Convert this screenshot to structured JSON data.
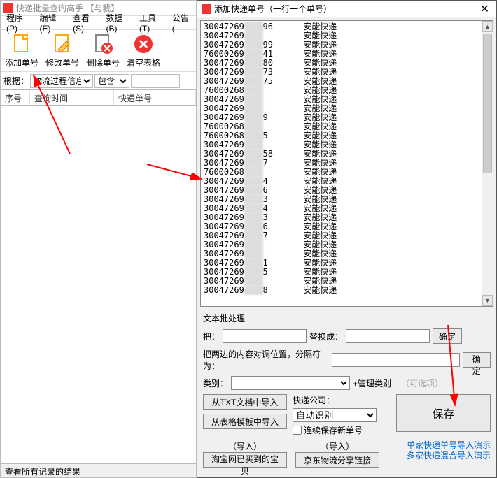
{
  "main": {
    "title": "快递批量查询高手 【与我】",
    "menu": [
      "程序(P)",
      "编辑(E)",
      "查看(S)",
      "数据(B)",
      "工具(T)",
      "公告("
    ],
    "toolbar": [
      {
        "name": "add",
        "label": "添加单号"
      },
      {
        "name": "edit",
        "label": "修改单号"
      },
      {
        "name": "del",
        "label": "删除单号"
      },
      {
        "name": "clear",
        "label": "清空表格"
      }
    ],
    "filter": {
      "root": "根据：",
      "sel1": "物流过程信息",
      "sel2": "包含",
      "q": ""
    },
    "cols": [
      "序号",
      "查询时间",
      "快递单号"
    ],
    "status": "查看所有记录的结果"
  },
  "dialog": {
    "title": "添加快递单号（一行一个单号）",
    "lines": [
      "30047269▮▮96      安能快递",
      "30047269▮▮        安能快递",
      "30047269▮▮99      安能快递",
      "76000269▮▮41      安能快递",
      "30047269▮▮80      安能快递",
      "30047269▮▮73      安能快递",
      "30047269▮▮75      安能快递",
      "76000268▮▮        安能快递",
      "30047269▮▮        安能快递",
      "30047269▮▮        安能快递",
      "30047269▮▮9       安能快递",
      "76000268▮▮        安能快递",
      "76000268▮▮5       安能快递",
      "30047269▮▮        安能快递",
      "30047269▮▮58      安能快递",
      "30047269▮▮7       安能快递",
      "76000268▮▮        安能快递",
      "30047269▮▮4       安能快递",
      "30047269▮▮6       安能快递",
      "30047269▮▮3       安能快递",
      "30047269▮▮4       安能快递",
      "30047269▮▮3       安能快递",
      "30047269▮▮6       安能快递",
      "30047269▮▮7       安能快递",
      "30047269▮▮        安能快递",
      "30047269▮▮        安能快递",
      "30047269▮▮1       安能快递",
      "30047269▮▮5       安能快递",
      "30047269▮▮        安能快递",
      "30047269▮▮8       安能快递"
    ],
    "batch": {
      "title": "文本批处理",
      "replace_lbl": "把：",
      "replace_to": "替换成：",
      "ok": "确定",
      "swap_lbl": "把两边的内容对调位置，分隔符为：",
      "cat_lbl": "类别：",
      "manage_cat": "+管理类别",
      "optional": "（可选项）",
      "import_txt": "从TXT文档中导入",
      "import_tpl": "从表格模板中导入",
      "courier_lbl": "快递公司：",
      "courier_val": "自动识别",
      "keep_new": "连续保存新单号",
      "save": "保存",
      "imp": "（导入）",
      "tb": "淘宝网已买到的宝贝",
      "jd": "京东物流分享链接",
      "link1": "单家快递单号导入演示",
      "link2": "多家快递混合导入演示"
    }
  }
}
